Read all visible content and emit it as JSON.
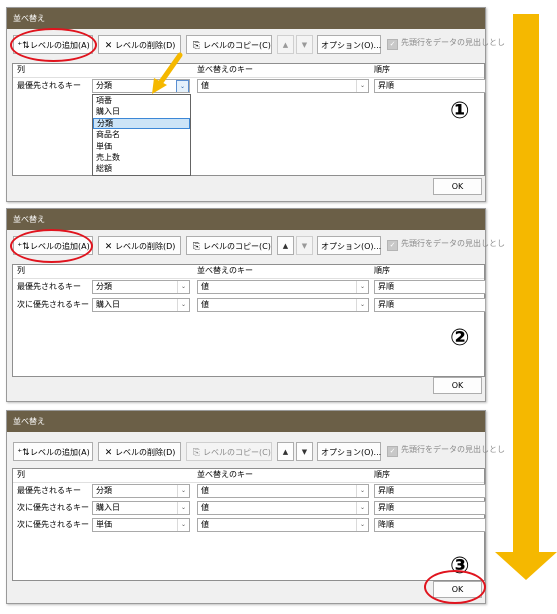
{
  "dialogs": [
    {
      "title": "並べ替え",
      "toolbar": {
        "add_level": "レベルの追加(A)",
        "delete_level": "レベルの削除(D)",
        "copy_level": "レベルのコピー(C)",
        "options": "オプション(O)...",
        "header_checkbox": "先頭行をデータの見出しとし"
      },
      "columns": {
        "col": "列",
        "key": "並べ替えのキー",
        "order": "順序"
      },
      "rows": [
        {
          "label": "最優先されるキー",
          "column": "分類",
          "key": "値",
          "order": "昇順"
        }
      ],
      "dropdown_options": [
        "項番",
        "購入日",
        "分類",
        "商品名",
        "単価",
        "売上数",
        "総額"
      ],
      "dropdown_selected": "分類",
      "ok_label": "OK",
      "step": "①"
    },
    {
      "title": "並べ替え",
      "toolbar": {
        "add_level": "レベルの追加(A)",
        "delete_level": "レベルの削除(D)",
        "copy_level": "レベルのコピー(C)",
        "options": "オプション(O)...",
        "header_checkbox": "先頭行をデータの見出しとし"
      },
      "columns": {
        "col": "列",
        "key": "並べ替えのキー",
        "order": "順序"
      },
      "rows": [
        {
          "label": "最優先されるキー",
          "column": "分類",
          "key": "値",
          "order": "昇順"
        },
        {
          "label": "次に優先されるキー",
          "column": "購入日",
          "key": "値",
          "order": "昇順"
        }
      ],
      "ok_label": "OK",
      "step": "②"
    },
    {
      "title": "並べ替え",
      "toolbar": {
        "add_level": "レベルの追加(A)",
        "delete_level": "レベルの削除(D)",
        "copy_level": "レベルのコピー(C)",
        "options": "オプション(O)...",
        "header_checkbox": "先頭行をデータの見出しとし"
      },
      "columns": {
        "col": "列",
        "key": "並べ替えのキー",
        "order": "順序"
      },
      "rows": [
        {
          "label": "最優先されるキー",
          "column": "分類",
          "key": "値",
          "order": "昇順"
        },
        {
          "label": "次に優先されるキー",
          "column": "購入日",
          "key": "値",
          "order": "昇順"
        },
        {
          "label": "次に優先されるキー",
          "column": "単価",
          "key": "値",
          "order": "降順"
        }
      ],
      "ok_label": "OK",
      "step": "③"
    }
  ],
  "colors": {
    "title_bar": "#6b5f47",
    "highlight_ring": "#e0141e",
    "flow_arrow": "#f5b800",
    "pointer_arrow": "#f5b800"
  }
}
